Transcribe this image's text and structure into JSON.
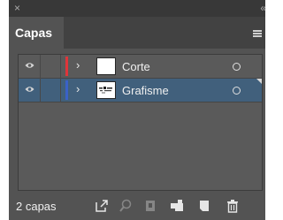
{
  "window": {
    "close_glyph": "×",
    "collapse_glyph": "«"
  },
  "tabs": [
    {
      "label": "Capas",
      "active": true
    }
  ],
  "layers": [
    {
      "name": "Corte",
      "color": "#e0353a",
      "visible": true,
      "selected": false,
      "thumbnail": "blank"
    },
    {
      "name": "Grafisme",
      "color": "#3a62c8",
      "visible": true,
      "selected": true,
      "thumbnail": "graphic"
    }
  ],
  "footer": {
    "count_label": "2 capas",
    "icons": [
      {
        "name": "export-icon",
        "enabled": true
      },
      {
        "name": "locate-object-icon",
        "enabled": false
      },
      {
        "name": "make-clipping-mask-icon",
        "enabled": false
      },
      {
        "name": "new-sublayer-icon",
        "enabled": true
      },
      {
        "name": "new-layer-icon",
        "enabled": true
      },
      {
        "name": "trash-icon",
        "enabled": true
      }
    ]
  },
  "colors": {
    "panel_bg": "#535353",
    "selected_row": "#41607c",
    "topbar": "#383838"
  }
}
